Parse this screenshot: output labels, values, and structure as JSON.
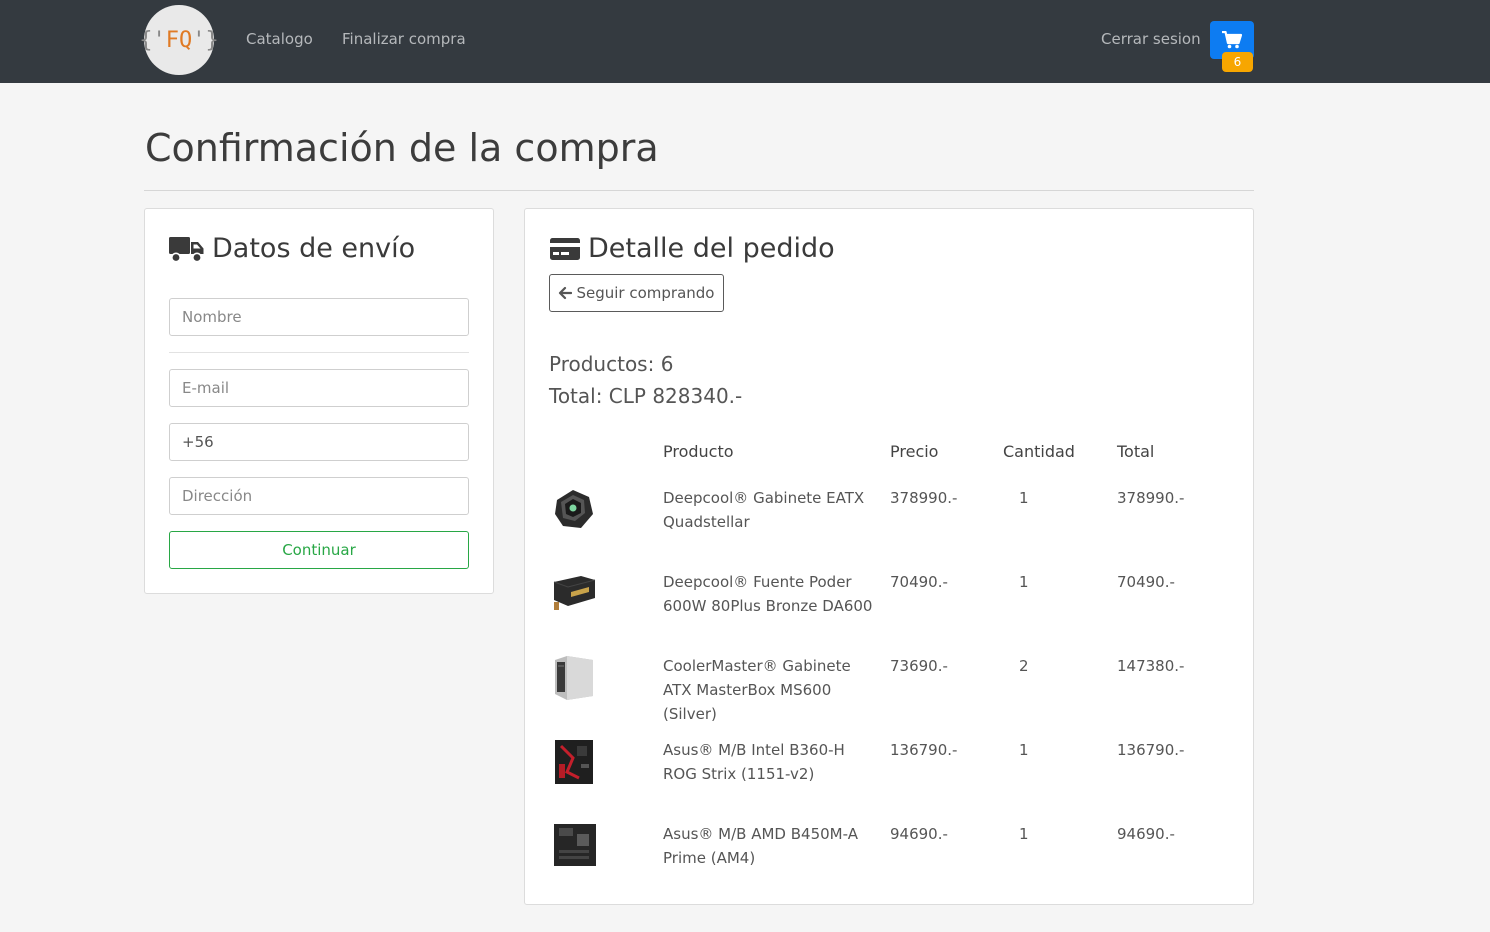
{
  "nav": {
    "logo_text": "{'FQ'}",
    "links": [
      "Catalogo",
      "Finalizar compra"
    ],
    "logout": "Cerrar sesion",
    "cart_count": "6"
  },
  "page": {
    "title": "Confirmación de la compra"
  },
  "shipping": {
    "heading": "Datos de envío",
    "name_placeholder": "Nombre",
    "email_placeholder": "E-mail",
    "phone_value": "+56",
    "address_placeholder": "Dirección",
    "continue_label": "Continuar"
  },
  "order": {
    "heading": "Detalle del pedido",
    "back_label": "Seguir comprando",
    "products_count": "Productos: 6",
    "total": "Total: CLP 828340.-",
    "columns": [
      "Producto",
      "Precio",
      "Cantidad",
      "Total"
    ],
    "items": [
      {
        "name": "Deepcool® Gabinete EATX Quadstellar",
        "price": "378990.-",
        "qty": "1",
        "total": "378990.-"
      },
      {
        "name": "Deepcool® Fuente Poder 600W 80Plus Bronze DA600",
        "price": "70490.-",
        "qty": "1",
        "total": "70490.-"
      },
      {
        "name": "CoolerMaster® Gabinete ATX MasterBox MS600 (Silver)",
        "price": "73690.-",
        "qty": "2",
        "total": "147380.-"
      },
      {
        "name": "Asus® M/B Intel B360-H ROG Strix (1151-v2)",
        "price": "136790.-",
        "qty": "1",
        "total": "136790.-"
      },
      {
        "name": "Asus® M/B AMD B450M-A Prime (AM4)",
        "price": "94690.-",
        "qty": "1",
        "total": "94690.-"
      }
    ]
  }
}
